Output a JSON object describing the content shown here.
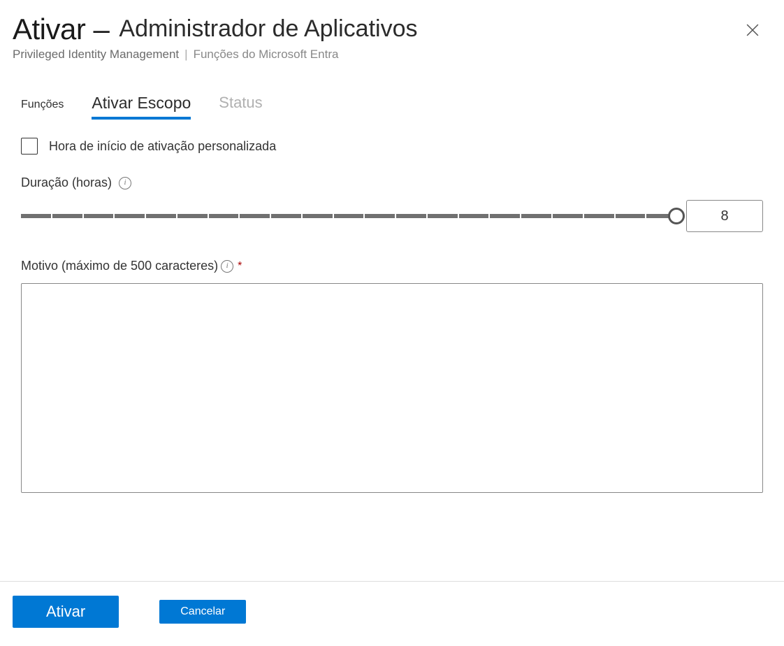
{
  "header": {
    "title_prefix": "Ativar –",
    "title_suffix": "Administrador de Aplicativos",
    "subtitle_1": "Privileged Identity Management",
    "subtitle_2": "Funções do Microsoft Entra"
  },
  "tabs": {
    "roles": "Funções",
    "activate_scope": "Ativar Escopo",
    "status": "Status"
  },
  "form": {
    "custom_start_label": "Hora de início de ativação personalizada",
    "duration_label": "Duração (horas)",
    "duration_value": "8",
    "reason_label": "Motivo (máximo de 500 caracteres)",
    "required_star": "*"
  },
  "footer": {
    "activate": "Ativar",
    "cancel": "Cancelar"
  },
  "icons": {
    "info": "i"
  }
}
